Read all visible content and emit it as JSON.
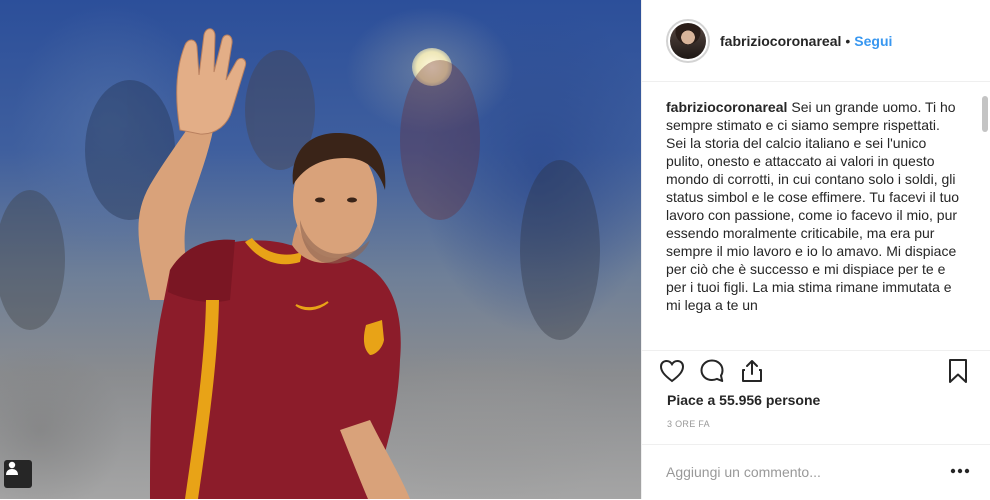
{
  "post": {
    "username": "fabriziocoronareal",
    "separator": "•",
    "follow_label": "Segui",
    "caption_text": "Sei un grande uomo. Ti ho sempre stimato e ci siamo sempre rispettati. Sei la storia del calcio italiano e sei l'unico pulito, onesto e attaccato ai valori in questo mondo di corrotti, in cui contano solo i soldi, gli status simbol e le cose effimere. Tu facevi il tuo lavoro con passione, come io facevo il mio, pur essendo moralmente criticabile, ma era pur sempre il mio lavoro e io lo amavo. Mi dispiace per ciò che è successo e mi dispiace per te e per i tuoi figli. La mia stima rimane immutata e mi lega a te un",
    "likes_text": "Piace a 55.956 persone",
    "time_ago": "3 ORE FA",
    "comment_placeholder": "Aggiungi un commento..."
  },
  "icons": {
    "like": "heart-icon",
    "comment": "comment-bubble-icon",
    "share": "share-icon",
    "save": "bookmark-icon",
    "more": "ellipsis-icon",
    "multi": "user-tag-icon"
  },
  "colors": {
    "accent_link": "#3897f0",
    "text": "#262626",
    "muted": "#999999",
    "border": "#efefef",
    "jersey": "#8c1c2a",
    "jersey_stripe": "#e8a317"
  }
}
